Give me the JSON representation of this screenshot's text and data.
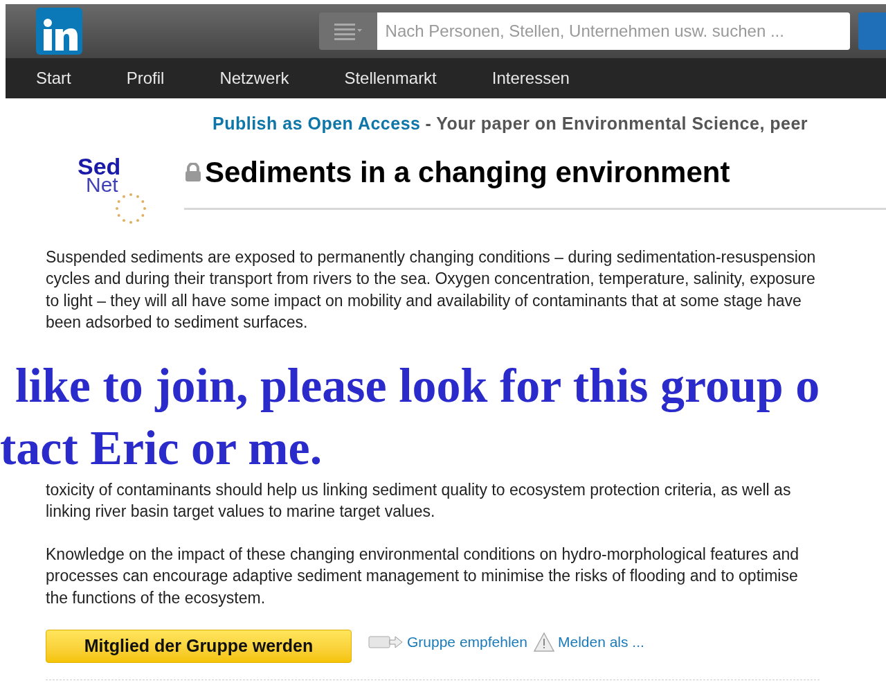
{
  "header": {
    "search": {
      "placeholder": "Nach Personen, Stellen, Unternehmen usw. suchen ..."
    }
  },
  "nav": [
    "Start",
    "Profil",
    "Netzwerk",
    "Stellenmarkt",
    "Interessen"
  ],
  "banner": {
    "link": "Publish as Open Access",
    "text": "- Your paper on Environmental Science, peer"
  },
  "group": {
    "logo_top": "Sed",
    "logo_bottom": "Net",
    "title": "Sediments in a changing environment",
    "locked": true
  },
  "paragraphs": [
    "Suspended sediments are exposed to permanently changing conditions – during sedimentation-resuspension cycles and during their transport from rivers to the sea. Oxygen concentration, temperature, salinity, exposure to light – they will all have some impact on mobility and availability of contaminants that at some stage have been adsorbed to sediment surfaces.",
    "toxicity of contaminants should help us linking sediment quality to ecosystem protection criteria, as well as linking river basin target values to marine target values.",
    "Knowledge on the impact of these changing environmental conditions on hydro-morphological features and processes can encourage adaptive sediment management to minimise the risks of flooding and to optimise the functions of the ecosystem."
  ],
  "overlay": [
    "like to join, please look for this group o",
    "tact Eric or me."
  ],
  "join_button": "Mitglied der Gruppe werden",
  "actions": [
    {
      "kind": "share",
      "label": "Gruppe empfehlen"
    },
    {
      "kind": "report",
      "label": "Melden als ..."
    }
  ]
}
